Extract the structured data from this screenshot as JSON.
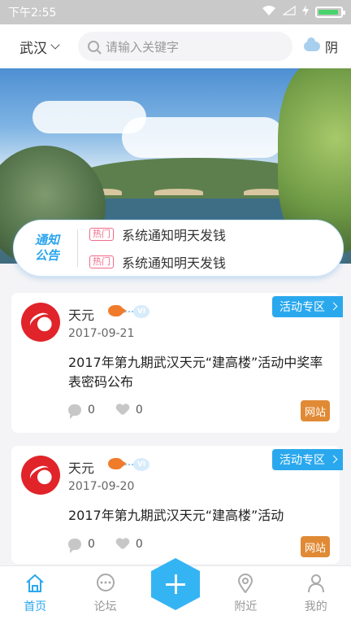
{
  "status_bar": {
    "time": "下午2:55"
  },
  "header": {
    "city": "武汉",
    "search_placeholder": "请输入关键字",
    "weather": "阴"
  },
  "notice": {
    "logo_line1": "通知",
    "logo_line2": "公告",
    "items": [
      {
        "badge": "热门",
        "text": "系统通知明天发钱"
      },
      {
        "badge": "热门",
        "text": "系统通知明天发钱"
      }
    ]
  },
  "posts": [
    {
      "user": "天元",
      "vip": "VI",
      "date": "2017-09-21",
      "tag": "活动专区",
      "title": "2017年第九期武汉天元“建高楼”活动中奖率表密码公布",
      "comments": "0",
      "likes": "0",
      "badge": "网站"
    },
    {
      "user": "天元",
      "vip": "VI",
      "date": "2017-09-20",
      "tag": "活动专区",
      "title": "2017年第九期武汉天元“建高楼”活动",
      "comments": "0",
      "likes": "0",
      "badge": "网站"
    }
  ],
  "bottom_nav": {
    "items": [
      {
        "label": "首页",
        "icon": "home-icon",
        "active": true
      },
      {
        "label": "论坛",
        "icon": "forum-icon",
        "active": false
      },
      {
        "label": "附近",
        "icon": "location-pin-icon",
        "active": false
      },
      {
        "label": "我的",
        "icon": "person-icon",
        "active": false
      }
    ],
    "fab_icon": "plus-icon"
  },
  "colors": {
    "accent": "#2aa8ee",
    "badge_orange": "#e08a35",
    "hot_pink": "#f06b8a"
  }
}
